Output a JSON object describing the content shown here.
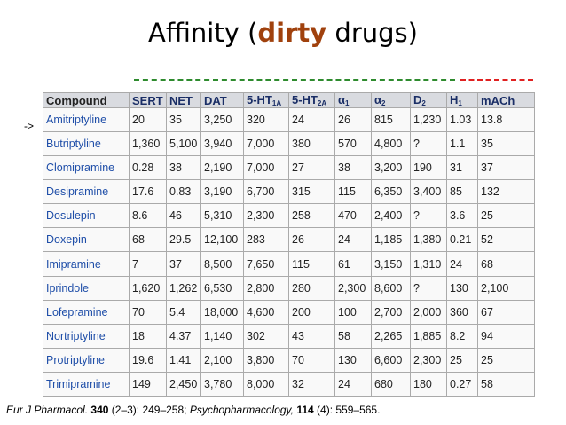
{
  "title": {
    "prefix": "Affinity (",
    "highlight": "dirty",
    "suffix": " drugs)"
  },
  "arrow": "->",
  "table": {
    "headers": [
      {
        "main": "Compound",
        "sub": ""
      },
      {
        "main": "SERT",
        "sub": ""
      },
      {
        "main": "NET",
        "sub": ""
      },
      {
        "main": "DAT",
        "sub": ""
      },
      {
        "main": "5-HT",
        "sub": "1A"
      },
      {
        "main": "5-HT",
        "sub": "2A"
      },
      {
        "main": "α",
        "sub": "1"
      },
      {
        "main": "α",
        "sub": "2"
      },
      {
        "main": "D",
        "sub": "2"
      },
      {
        "main": "H",
        "sub": "1"
      },
      {
        "main": "mACh",
        "sub": ""
      }
    ],
    "rows": [
      [
        "Amitriptyline",
        "20",
        "35",
        "3,250",
        "320",
        "24",
        "26",
        "815",
        "1,230",
        "1.03",
        "13.8"
      ],
      [
        "Butriptyline",
        "1,360",
        "5,100",
        "3,940",
        "7,000",
        "380",
        "570",
        "4,800",
        "?",
        "1.1",
        "35"
      ],
      [
        "Clomipramine",
        "0.28",
        "38",
        "2,190",
        "7,000",
        "27",
        "38",
        "3,200",
        "190",
        "31",
        "37"
      ],
      [
        "Desipramine",
        "17.6",
        "0.83",
        "3,190",
        "6,700",
        "315",
        "115",
        "6,350",
        "3,400",
        "85",
        "132"
      ],
      [
        "Dosulepin",
        "8.6",
        "46",
        "5,310",
        "2,300",
        "258",
        "470",
        "2,400",
        "?",
        "3.6",
        "25"
      ],
      [
        "Doxepin",
        "68",
        "29.5",
        "12,100",
        "283",
        "26",
        "24",
        "1,185",
        "1,380",
        "0.21",
        "52"
      ],
      [
        "Imipramine",
        "7",
        "37",
        "8,500",
        "7,650",
        "115",
        "61",
        "3,150",
        "1,310",
        "24",
        "68"
      ],
      [
        "Iprindole",
        "1,620",
        "1,262",
        "6,530",
        "2,800",
        "280",
        "2,300",
        "8,600",
        "?",
        "130",
        "2,100"
      ],
      [
        "Lofepramine",
        "70",
        "5.4",
        "18,000",
        "4,600",
        "200",
        "100",
        "2,700",
        "2,000",
        "360",
        "67"
      ],
      [
        "Nortriptyline",
        "18",
        "4.37",
        "1,140",
        "302",
        "43",
        "58",
        "2,265",
        "1,885",
        "8.2",
        "94"
      ],
      [
        "Protriptyline",
        "19.6",
        "1.41",
        "2,100",
        "3,800",
        "70",
        "130",
        "6,600",
        "2,300",
        "25",
        "25"
      ],
      [
        "Trimipramine",
        "149",
        "2,450",
        "3,780",
        "8,000",
        "32",
        "24",
        "680",
        "180",
        "0.27",
        "58"
      ]
    ]
  },
  "reference": {
    "j1": "Eur J Pharmacol.",
    "v1": "340",
    "r1": " (2–3): 249–258; ",
    "j2": "Psychopharmacology,",
    "v2": "114",
    "r2": " (4): 559–565."
  },
  "colors": {
    "highlight": "#a0410d",
    "green_dash": "#2e8b2e",
    "red_dash": "#e02020",
    "link": "#1f4ea8"
  }
}
